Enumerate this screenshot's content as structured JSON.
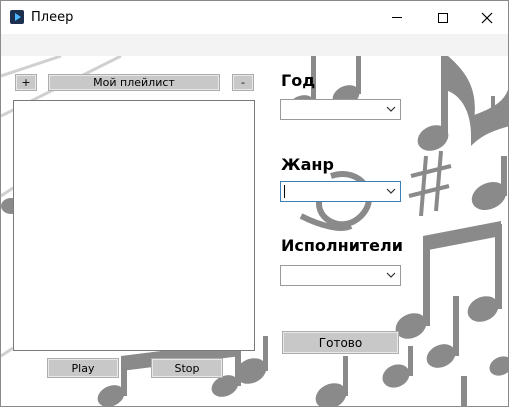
{
  "window": {
    "title": "Плеер",
    "app_icon": "media-player-icon",
    "controls": [
      "minimize-icon",
      "maximize-icon",
      "close-icon"
    ]
  },
  "playlist": {
    "add_label": "+",
    "name_label": "Мой плейлист",
    "remove_label": "-",
    "items": []
  },
  "playback": {
    "play_label": "Play",
    "stop_label": "Stop"
  },
  "filters": {
    "year_label": "Год",
    "year_value": "",
    "genre_label": "Жанр",
    "genre_value": "",
    "artists_label": "Исполнители",
    "artists_value": ""
  },
  "submit": {
    "label": "Готово"
  },
  "colors": {
    "button_face": "#c8c8c8",
    "note_gray": "#7f7f7f",
    "focus_border": "#3c7fb1"
  }
}
